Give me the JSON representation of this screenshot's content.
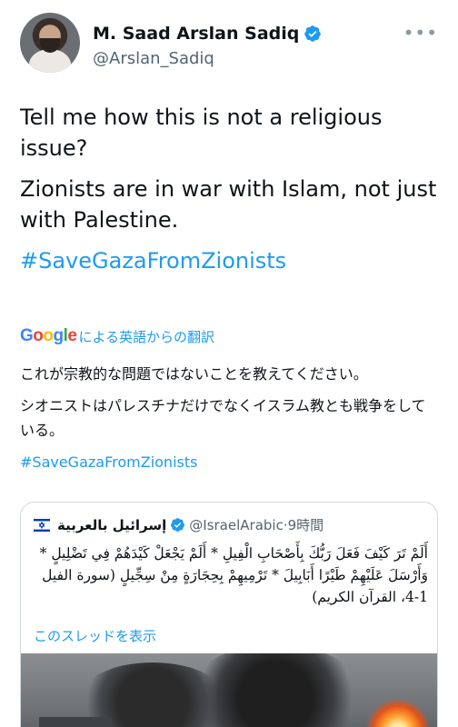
{
  "author": {
    "name": "M. Saad Arslan Sadiq",
    "handle": "@Arslan_Sadiq",
    "more_icon": "•••"
  },
  "tweet": {
    "line1": "Tell me how this is not a religious issue?",
    "line2": "Zionists are in war with Islam, not just with Palestine.",
    "hashtag": "#SaveGazaFromZionists"
  },
  "translation": {
    "google_letters": [
      "G",
      "o",
      "o",
      "g",
      "l",
      "e"
    ],
    "google_colors": [
      "#4285F4",
      "#EA4335",
      "#FBBC05",
      "#4285F4",
      "#34A853",
      "#EA4335"
    ],
    "label": "による英語からの翻訳",
    "line1": "これが宗教的な問題ではないことを教えてください。",
    "line2": "シオニストはパレスチナだけでなくイスラム教とも戦争をしている。",
    "hashtag": "#SaveGazaFromZionists"
  },
  "quote": {
    "name": "إسرائيل بالعربية",
    "handle": "@IsraelArabic",
    "separator": "·",
    "time": "9時間",
    "text": "أَلَمْ تَرَ كَيْفَ فَعَلَ رَبُّكَ بِأَصْحَابِ الْفِيلِ * أَلَمْ يَجْعَلْ كَيْدَهُمْ فِي تَضْلِيلٍ * وَأَرْسَلَ عَلَيْهِمْ طَيْرًا أَبَابِيلَ * تَرْمِيهِمْ بِحِجَارَةٍ مِنْ سِجِّيلٍ (سورة الفيل 1-4، القرآن الكريم)",
    "thread_link": "このスレッドを表示"
  },
  "colors": {
    "accent": "#1d9bf0",
    "text": "#0f1419",
    "secondary": "#536471"
  }
}
